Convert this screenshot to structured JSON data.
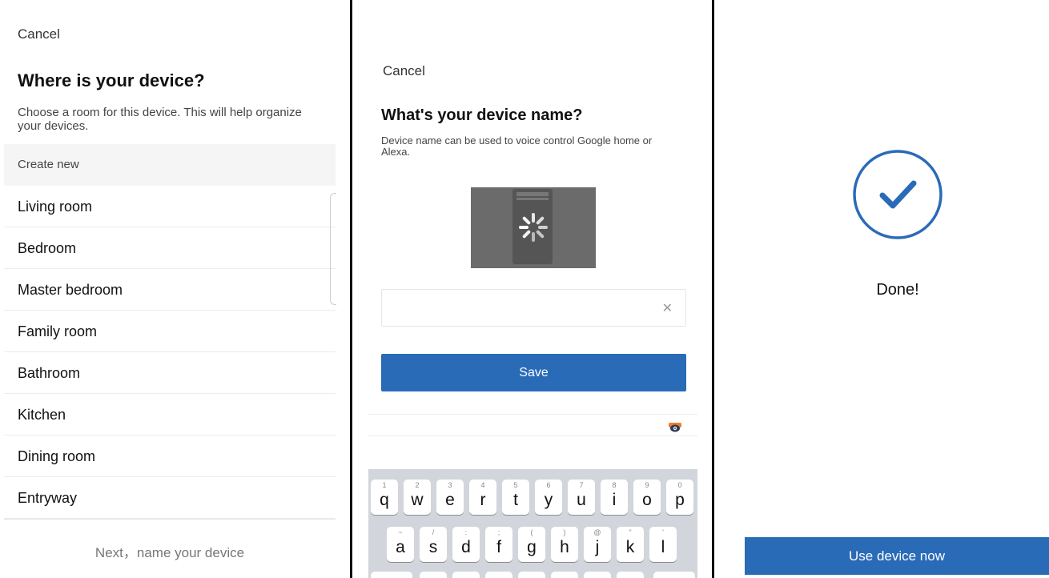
{
  "room_screen": {
    "cancel_label": "Cancel",
    "title": "Where is your device?",
    "description": "Choose a room for this device. This will help organize your devices.",
    "create_new_label": "Create new",
    "rooms": [
      "Living room",
      "Bedroom",
      "Master bedroom",
      "Family room",
      "Bathroom",
      "Kitchen",
      "Dining room",
      "Entryway"
    ],
    "next_label": "Next，name your device"
  },
  "name_screen": {
    "cancel_label": "Cancel",
    "title": "What's your device name?",
    "description": "Device name can be used to voice control Google home or Alexa.",
    "name_input_value": "",
    "save_label": "Save",
    "keyboard_row1": [
      {
        "hint": "1",
        "key": "q"
      },
      {
        "hint": "2",
        "key": "w"
      },
      {
        "hint": "3",
        "key": "e"
      },
      {
        "hint": "4",
        "key": "r"
      },
      {
        "hint": "5",
        "key": "t"
      },
      {
        "hint": "6",
        "key": "y"
      },
      {
        "hint": "7",
        "key": "u"
      },
      {
        "hint": "8",
        "key": "i"
      },
      {
        "hint": "9",
        "key": "o"
      },
      {
        "hint": "0",
        "key": "p"
      }
    ],
    "keyboard_row2": [
      {
        "hint": "~",
        "key": "a"
      },
      {
        "hint": "/",
        "key": "s"
      },
      {
        "hint": ":",
        "key": "d"
      },
      {
        "hint": ";",
        "key": "f"
      },
      {
        "hint": "(",
        "key": "g"
      },
      {
        "hint": ")",
        "key": "h"
      },
      {
        "hint": "@",
        "key": "j"
      },
      {
        "hint": "\"",
        "key": "k"
      },
      {
        "hint": "'",
        "key": "l"
      }
    ]
  },
  "done_screen": {
    "done_label": "Done!",
    "use_device_label": "Use device now"
  },
  "colors": {
    "primary": "#2a6bb8",
    "divider": "#111111",
    "keyboard_bg": "#d2d5db"
  }
}
